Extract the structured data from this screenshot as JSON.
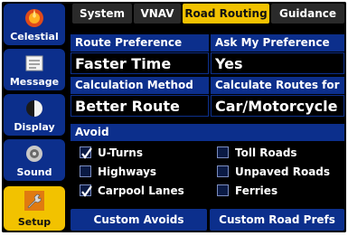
{
  "sidebar": {
    "items": [
      {
        "label": "Celestial",
        "icon": "celestial-icon",
        "active": false
      },
      {
        "label": "Message",
        "icon": "message-icon",
        "active": false
      },
      {
        "label": "Display",
        "icon": "display-icon",
        "active": false
      },
      {
        "label": "Sound",
        "icon": "sound-icon",
        "active": false
      },
      {
        "label": "Setup",
        "icon": "setup-wrench-icon",
        "active": true
      }
    ]
  },
  "tabs": [
    {
      "label": "System",
      "active": false
    },
    {
      "label": "VNAV",
      "active": false
    },
    {
      "label": "Road Routing",
      "active": true
    },
    {
      "label": "Guidance",
      "active": false
    }
  ],
  "settings": {
    "route_preference": {
      "label": "Route Preference",
      "value": "Faster Time"
    },
    "ask_my_preference": {
      "label": "Ask My Preference",
      "value": "Yes"
    },
    "calculation_method": {
      "label": "Calculation Method",
      "value": "Better Route"
    },
    "calculate_routes_for": {
      "label": "Calculate Routes for",
      "value": "Car/Motorcycle"
    }
  },
  "avoid": {
    "label": "Avoid",
    "items": [
      {
        "label": "U-Turns",
        "checked": true
      },
      {
        "label": "Highways",
        "checked": false
      },
      {
        "label": "Carpool Lanes",
        "checked": true
      },
      {
        "label": "Toll Roads",
        "checked": false
      },
      {
        "label": "Unpaved Roads",
        "checked": false
      },
      {
        "label": "Ferries",
        "checked": false
      }
    ]
  },
  "buttons": {
    "custom_avoids": "Custom Avoids",
    "custom_road_prefs": "Custom Road Prefs"
  },
  "colors": {
    "panel_blue": "#0c2f8c",
    "active_yellow": "#f2c200",
    "background": "#000000"
  }
}
